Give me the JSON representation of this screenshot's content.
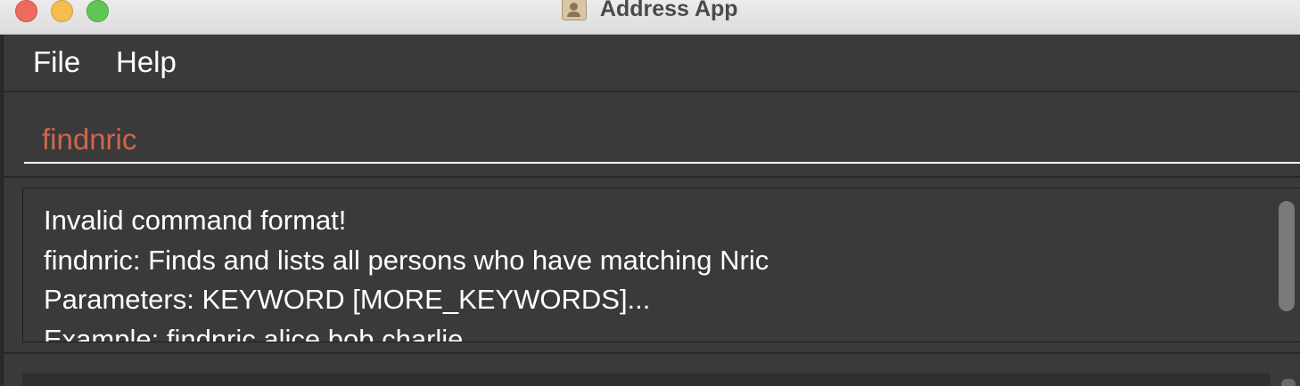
{
  "window": {
    "title": "Address App"
  },
  "menu": {
    "items": [
      {
        "label": "File"
      },
      {
        "label": "Help"
      }
    ]
  },
  "command_box": {
    "value": "findnric",
    "text_color": "#d0644f"
  },
  "result_display": {
    "lines": [
      "Invalid command format!",
      "findnric: Finds and lists all persons who have matching Nric",
      "Parameters: KEYWORD [MORE_KEYWORDS]...",
      "Example: findnric alice bob charlie"
    ]
  },
  "colors": {
    "background": "#3a3a3a",
    "text": "#ffffff",
    "close": "#ee6a5e",
    "minimize": "#f5bd4f",
    "maximize": "#61c554"
  }
}
